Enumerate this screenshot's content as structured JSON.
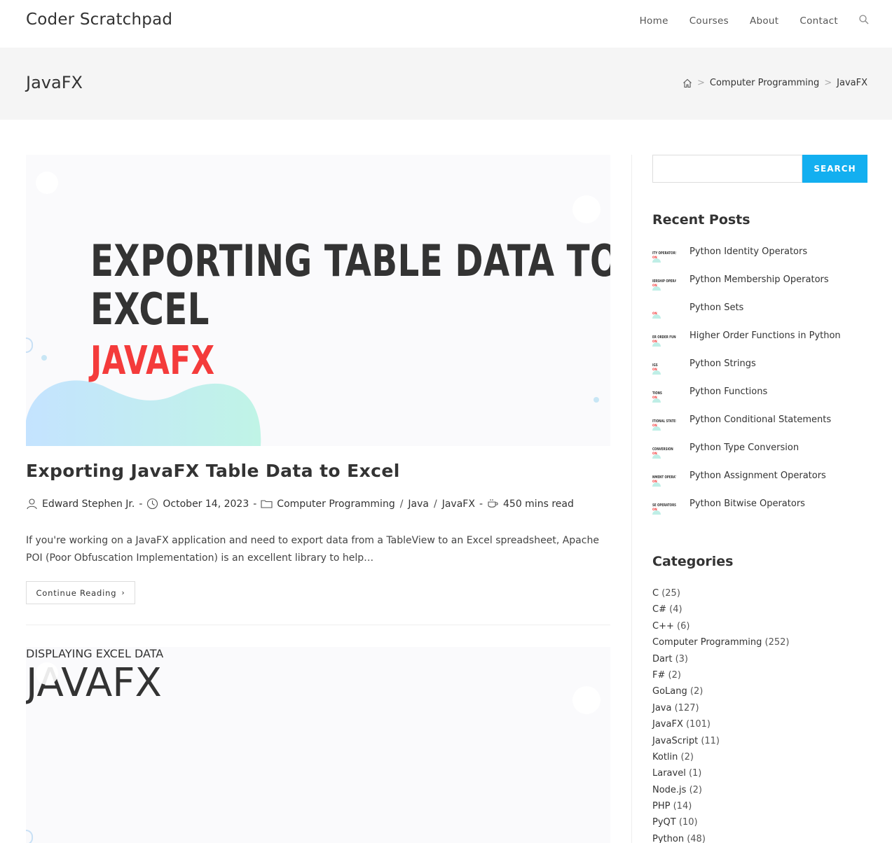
{
  "header": {
    "site_title": "Coder Scratchpad",
    "nav": [
      "Home",
      "Courses",
      "About",
      "Contact"
    ]
  },
  "page_header": {
    "title": "JavaFX",
    "breadcrumb": [
      "Computer Programming",
      "JavaFX"
    ]
  },
  "posts": [
    {
      "image_line1": "EXPORTING TABLE DATA TO",
      "image_line2": "EXCEL",
      "image_line3": "JAVAFX",
      "title": "Exporting JavaFX Table Data to Excel",
      "author": "Edward Stephen Jr.",
      "date": "October 14, 2023",
      "categories": [
        "Computer Programming",
        "Java",
        "JavaFX"
      ],
      "read_time": "450 mins read",
      "excerpt": "If you're working on a JavaFX application and need to export data from a TableView to an Excel spreadsheet, Apache POI (Poor Obfuscation Implementation) is an excellent library to help…",
      "continue_label": "Continue Reading"
    },
    {
      "image_line1": "DISPLAYING EXCEL DATA",
      "image_line2": "JAVAFX"
    }
  ],
  "sidebar": {
    "search_button": "SEARCH",
    "recent_title": "Recent Posts",
    "recent_posts": [
      {
        "title": "Python Identity Operators",
        "thumb": "ITY OPERATORS"
      },
      {
        "title": "Python Membership Operators",
        "thumb": "IERSHIP OPERATORS"
      },
      {
        "title": "Python Sets",
        "thumb": ""
      },
      {
        "title": "Higher Order Functions in Python",
        "thumb": "ER ORDER FUNCTIONS"
      },
      {
        "title": "Python Strings",
        "thumb": "IGS"
      },
      {
        "title": "Python Functions",
        "thumb": "TIONS"
      },
      {
        "title": "Python Conditional Statements",
        "thumb": "ITIONAL STATEMENT"
      },
      {
        "title": "Python Type Conversion",
        "thumb": "CONVERSION"
      },
      {
        "title": "Python Assignment Operators",
        "thumb": "NMENT OPERATORS"
      },
      {
        "title": "Python Bitwise Operators",
        "thumb": "SE OPERATORS"
      }
    ],
    "thumb_tag": "ON",
    "categories_title": "Categories",
    "categories": [
      {
        "name": "C",
        "count": "(25)"
      },
      {
        "name": "C#",
        "count": "(4)"
      },
      {
        "name": "C++",
        "count": "(6)"
      },
      {
        "name": "Computer Programming",
        "count": "(252)"
      },
      {
        "name": "Dart",
        "count": "(3)"
      },
      {
        "name": "F#",
        "count": "(2)"
      },
      {
        "name": "GoLang",
        "count": "(2)"
      },
      {
        "name": "Java",
        "count": "(127)"
      },
      {
        "name": "JavaFX",
        "count": "(101)"
      },
      {
        "name": "JavaScript",
        "count": "(11)"
      },
      {
        "name": "Kotlin",
        "count": "(2)"
      },
      {
        "name": "Laravel",
        "count": "(1)"
      },
      {
        "name": "Node.js",
        "count": "(2)"
      },
      {
        "name": "PHP",
        "count": "(14)"
      },
      {
        "name": "PyQT",
        "count": "(10)"
      },
      {
        "name": "Python",
        "count": "(48)"
      }
    ]
  },
  "colors": {
    "accent": "#13aff0",
    "red": "#f43b3b",
    "page_header_bg": "#f5f5f5"
  }
}
